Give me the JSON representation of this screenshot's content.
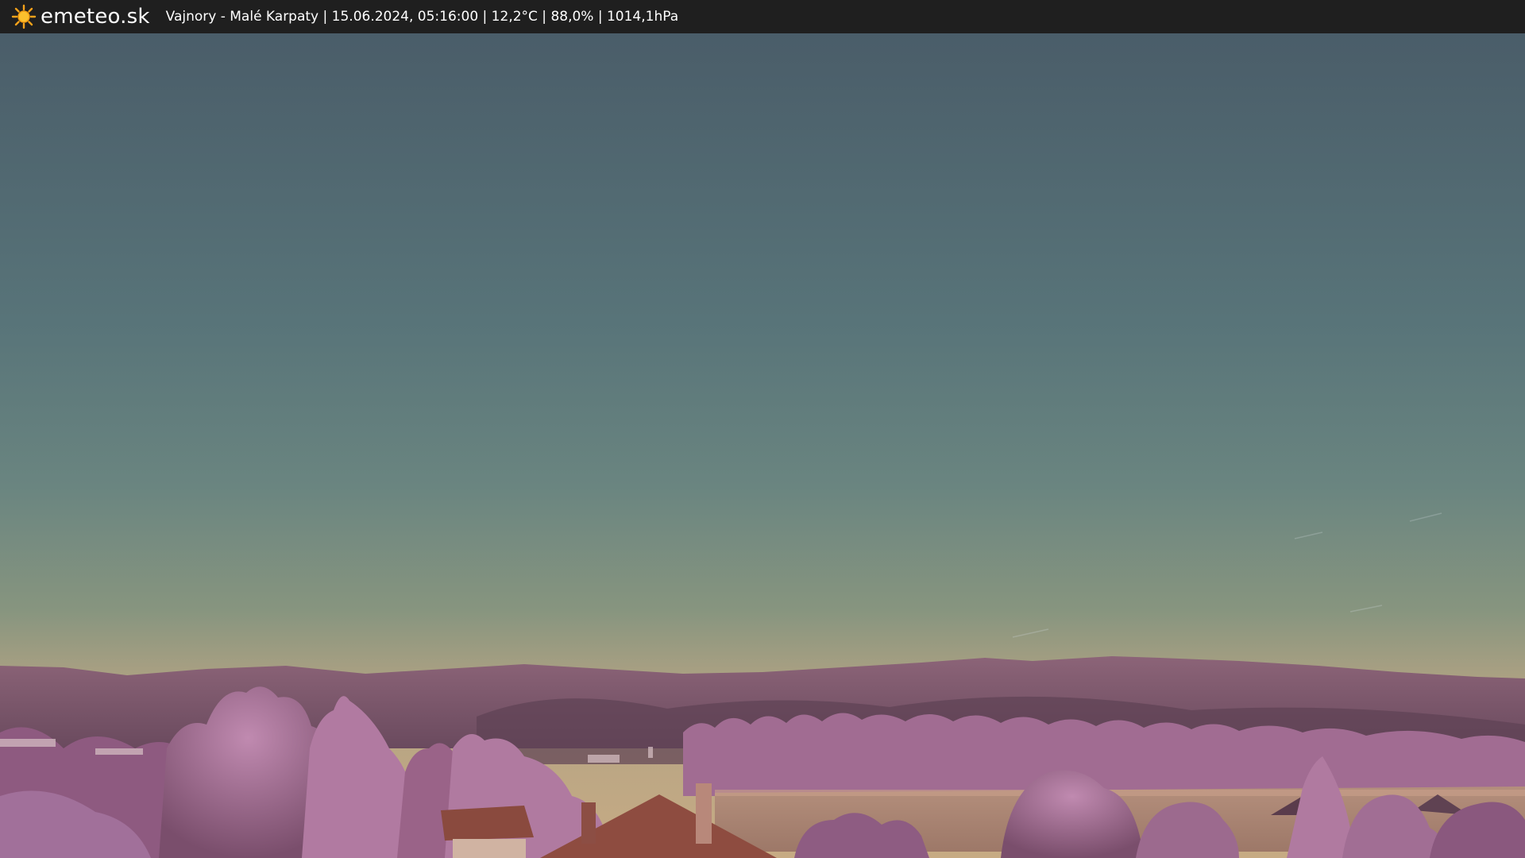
{
  "header": {
    "brand": "emeteo.sk",
    "caption": "Vajnory - Malé Karpaty | 15.06.2024, 05:16:00 | 12,2°C | 88,0% | 1014,1hPa"
  },
  "icons": {
    "logo": "sun-icon"
  },
  "colors": {
    "topbar": "#1f1f1f",
    "sky_top": "#4a5f6b",
    "sky_mid": "#5f7c80",
    "sky_low": "#8b967e",
    "horizon": "#b8a582",
    "hills": "#7e5a72",
    "foliage": "#a06c94",
    "roof": "#8a4a3e"
  }
}
